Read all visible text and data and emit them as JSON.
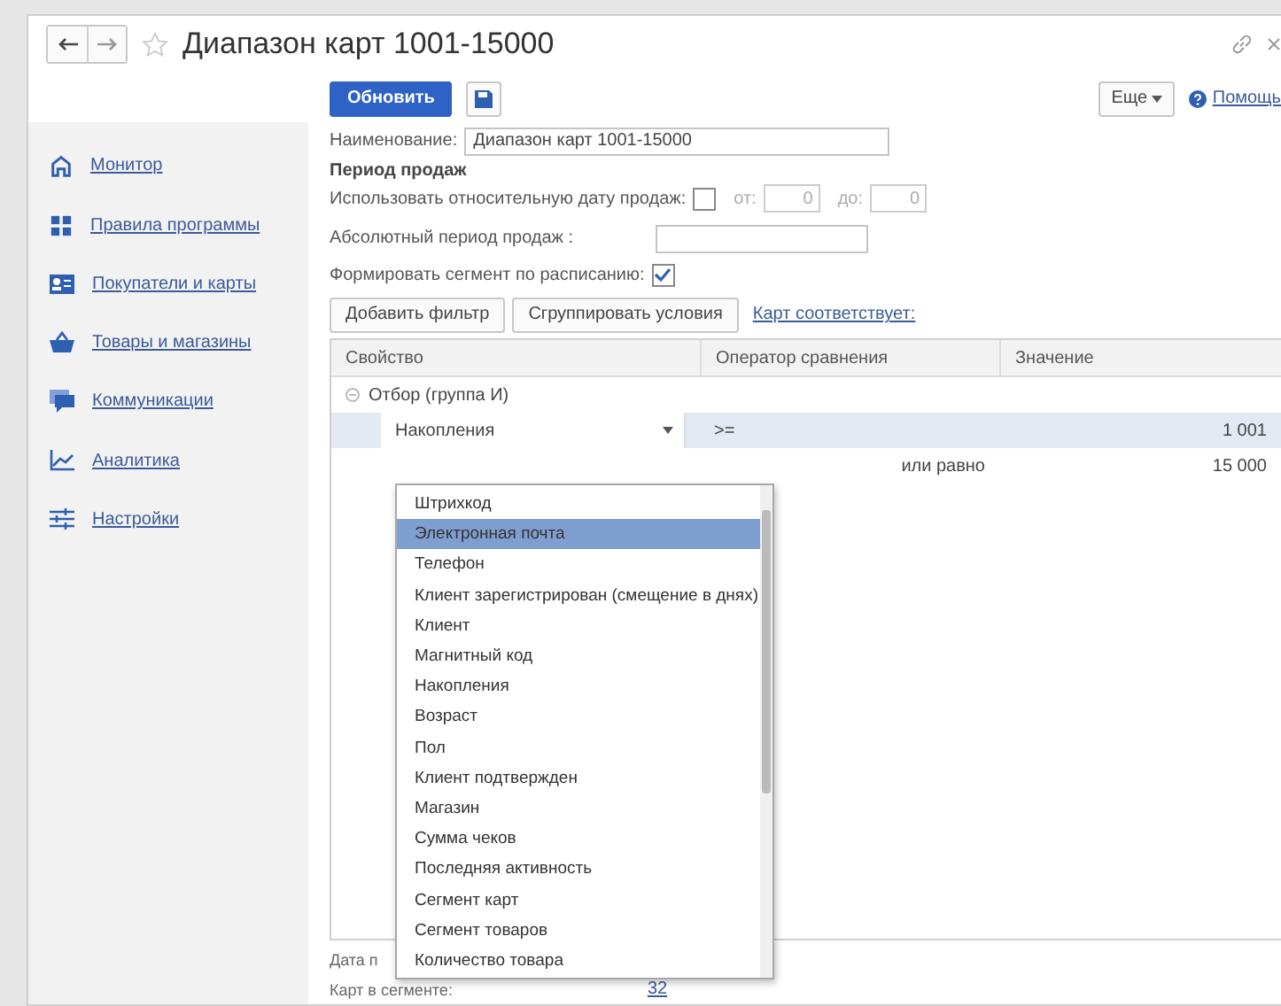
{
  "window": {
    "title": "Диапазон карт 1001-15000"
  },
  "sidebar": {
    "items": [
      {
        "label": "Монитор"
      },
      {
        "label": "Правила программы"
      },
      {
        "label": "Покупатели и карты"
      },
      {
        "label": "Товары и магазины"
      },
      {
        "label": "Коммуникации"
      },
      {
        "label": "Аналитика"
      },
      {
        "label": "Настройки"
      }
    ]
  },
  "toolbar": {
    "refresh_button": "Обновить",
    "more_button": "Еще",
    "help_link": "Помощь"
  },
  "form": {
    "name_label": "Наименование:",
    "name_value": "Диапазон карт 1001-15000",
    "period_heading": "Период продаж",
    "relative_label": "Использовать относительную дату продаж:",
    "relative_checked": false,
    "from_label": "от:",
    "from_value": "0",
    "to_label": "до:",
    "to_value": "0",
    "absolute_label": "Абсолютный период продаж :",
    "schedule_label": "Формировать сегмент по расписанию:",
    "schedule_checked": true
  },
  "filter_bar": {
    "buttons": [
      "Добавить фильтр",
      "Сгруппировать условия"
    ],
    "match_link": "Карт соответствует:"
  },
  "table": {
    "columns": [
      "Свойство",
      "Оператор сравнения",
      "Значение"
    ],
    "group": {
      "label": "Отбор (группа И)",
      "expanded": true
    },
    "rows": [
      {
        "property": "Накопления",
        "operator": ">=",
        "value": "1 001",
        "selected": true
      },
      {
        "operator": "или равно",
        "value": "15 000",
        "selected": false
      }
    ]
  },
  "dropdown": {
    "items": [
      {
        "label": "Штрихкод",
        "selected": false
      },
      {
        "label": "Электронная почта",
        "selected": true
      },
      {
        "label": "Телефон",
        "selected": false
      },
      {
        "label": "Клиент зарегистрирован (смещение в днях)",
        "selected": false
      },
      {
        "label": "Клиент",
        "selected": false
      },
      {
        "label": "Магнитный код",
        "selected": false
      },
      {
        "label": "Накопления",
        "selected": false
      },
      {
        "label": "Возраст",
        "selected": false
      },
      {
        "label": "Пол",
        "selected": false
      },
      {
        "label": "Клиент подтвержден",
        "selected": false
      },
      {
        "label": "Магазин",
        "selected": false
      },
      {
        "label": "Сумма чеков",
        "selected": false
      },
      {
        "label": "Последняя активность",
        "selected": false
      },
      {
        "label": "Сегмент карт",
        "selected": false
      },
      {
        "label": "Сегмент товаров",
        "selected": false
      },
      {
        "label": "Количество товара",
        "selected": false
      }
    ]
  },
  "footer": {
    "date_label": "Дата п",
    "cards_label": "Карт в сегменте:",
    "cards_value": "32"
  }
}
